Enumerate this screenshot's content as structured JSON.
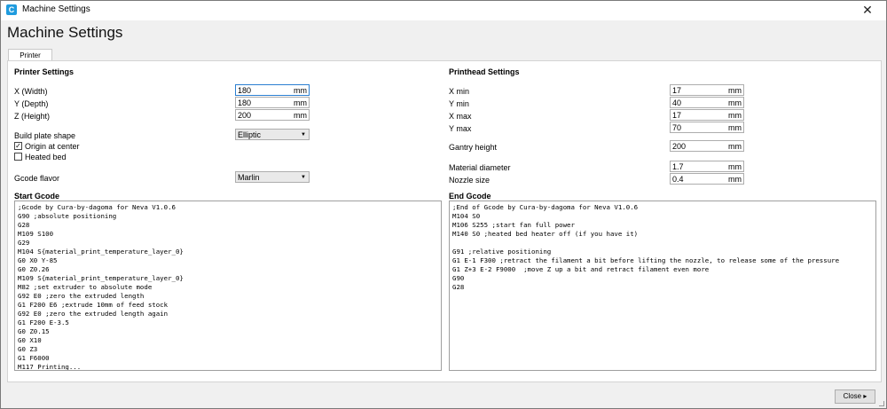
{
  "window": {
    "title": "Machine Settings",
    "close_glyph": "✕"
  },
  "heading": "Machine Settings",
  "tabs": [
    {
      "label": "Printer"
    }
  ],
  "printer": {
    "title": "Printer Settings",
    "x_label": "X (Width)",
    "x_value": "180",
    "x_unit": "mm",
    "y_label": "Y (Depth)",
    "y_value": "180",
    "y_unit": "mm",
    "z_label": "Z (Height)",
    "z_value": "200",
    "z_unit": "mm",
    "plate_label": "Build plate shape",
    "plate_value": "Elliptic",
    "origin_label": "Origin at center",
    "origin_checked": true,
    "heated_label": "Heated bed",
    "heated_checked": false,
    "flavor_label": "Gcode flavor",
    "flavor_value": "Marlin"
  },
  "printhead": {
    "title": "Printhead Settings",
    "xmin_label": "X min",
    "xmin_value": "17",
    "xmin_unit": "mm",
    "ymin_label": "Y min",
    "ymin_value": "40",
    "ymin_unit": "mm",
    "xmax_label": "X max",
    "xmax_value": "17",
    "xmax_unit": "mm",
    "ymax_label": "Y max",
    "ymax_value": "70",
    "ymax_unit": "mm",
    "gantry_label": "Gantry height",
    "gantry_value": "200",
    "gantry_unit": "mm",
    "material_label": "Material diameter",
    "material_value": "1.7",
    "material_unit": "mm",
    "nozzle_label": "Nozzle size",
    "nozzle_value": "0.4",
    "nozzle_unit": "mm"
  },
  "start_gcode": {
    "title": "Start Gcode",
    "text": ";Gcode by Cura-by-dagoma for Neva V1.0.6\nG90 ;absolute positioning\nG28\nM109 S100\nG29\nM104 S{material_print_temperature_layer_0}\nG0 X0 Y-85\nG0 Z0.26\nM109 S{material_print_temperature_layer_0}\nM82 ;set extruder to absolute mode\nG92 E0 ;zero the extruded length\nG1 F200 E6 ;extrude 10mm of feed stock\nG92 E0 ;zero the extruded length again\nG1 F200 E-3.5\nG0 Z0.15\nG0 X10\nG0 Z3\nG1 F6000\nM117 Printing..."
  },
  "end_gcode": {
    "title": "End Gcode",
    "text": ";End of Gcode by Cura-by-dagoma for Neva V1.0.6\nM104 S0\nM106 S255 ;start fan full power\nM140 S0 ;heated bed heater off (if you have it)\n\nG91 ;relative positioning\nG1 E-1 F300 ;retract the filament a bit before lifting the nozzle, to release some of the pressure\nG1 Z+3 E-2 F9000  ;move Z up a bit and retract filament even more\nG90\nG28"
  },
  "footer": {
    "close_label": "Close ▸"
  }
}
